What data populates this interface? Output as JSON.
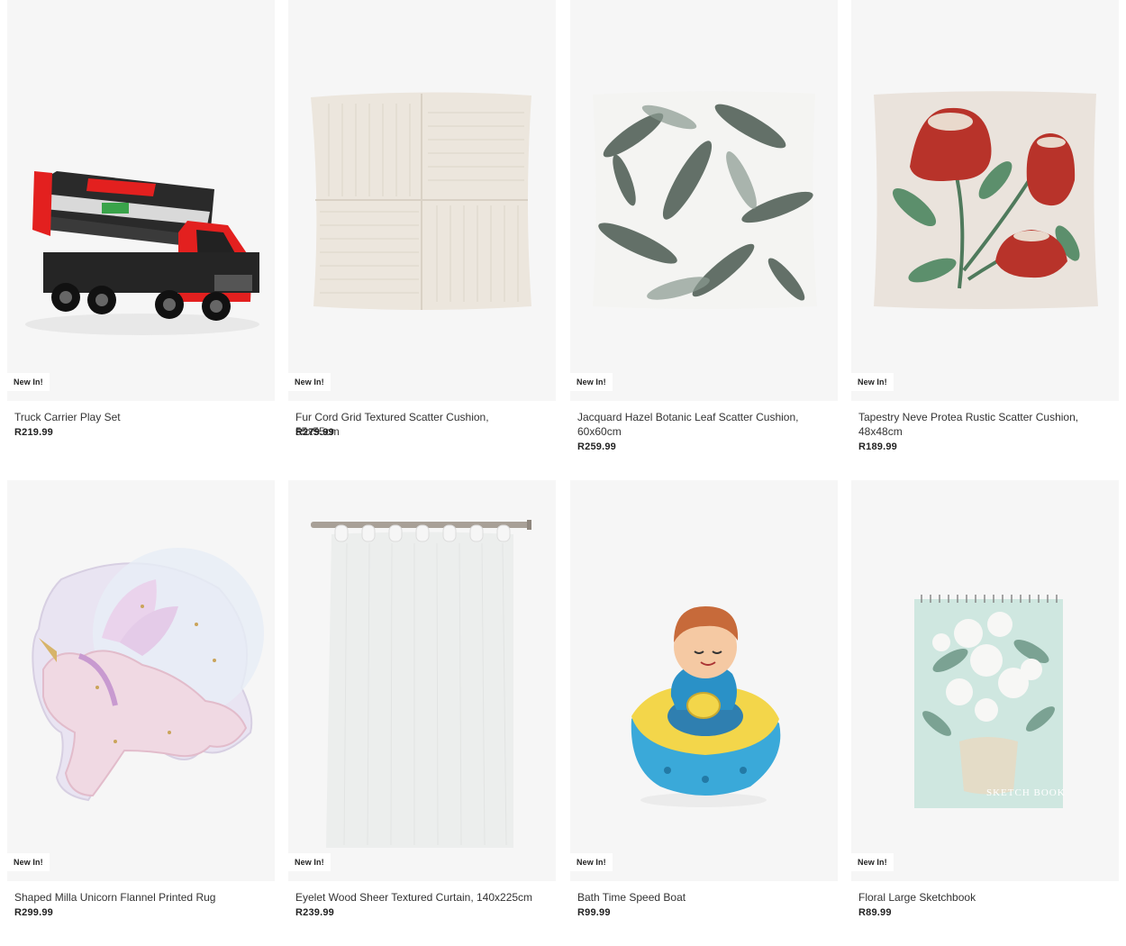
{
  "products": [
    {
      "name": "Truck Carrier Play Set",
      "price": "R219.99",
      "badge": "New In!",
      "image": "truck-carrier-image"
    },
    {
      "name": "Fur Cord Grid Textured Scatter Cushion, 55x55cm",
      "price": "R279.99",
      "badge": "New In!",
      "image": "cream-cushion-image"
    },
    {
      "name": "Jacquard Hazel Botanic Leaf Scatter Cushion, 60x60cm",
      "price": "R259.99",
      "badge": "New In!",
      "image": "leaf-cushion-image"
    },
    {
      "name": "Tapestry Neve Protea Rustic Scatter Cushion, 48x48cm",
      "price": "R189.99",
      "badge": "New In!",
      "image": "protea-cushion-image"
    },
    {
      "name": "Shaped Milla Unicorn Flannel Printed Rug",
      "price": "R299.99",
      "badge": "New In!",
      "image": "unicorn-rug-image"
    },
    {
      "name": "Eyelet Wood Sheer Textured Curtain, 140x225cm",
      "price": "R239.99",
      "badge": "New In!",
      "image": "sheer-curtain-image"
    },
    {
      "name": "Bath Time Speed Boat",
      "price": "R99.99",
      "badge": "New In!",
      "image": "speed-boat-image"
    },
    {
      "name": "Floral Large Sketchbook",
      "price": "R89.99",
      "badge": "New In!",
      "image": "sketchbook-image",
      "cover_text": "SKETCH BOOK"
    }
  ]
}
